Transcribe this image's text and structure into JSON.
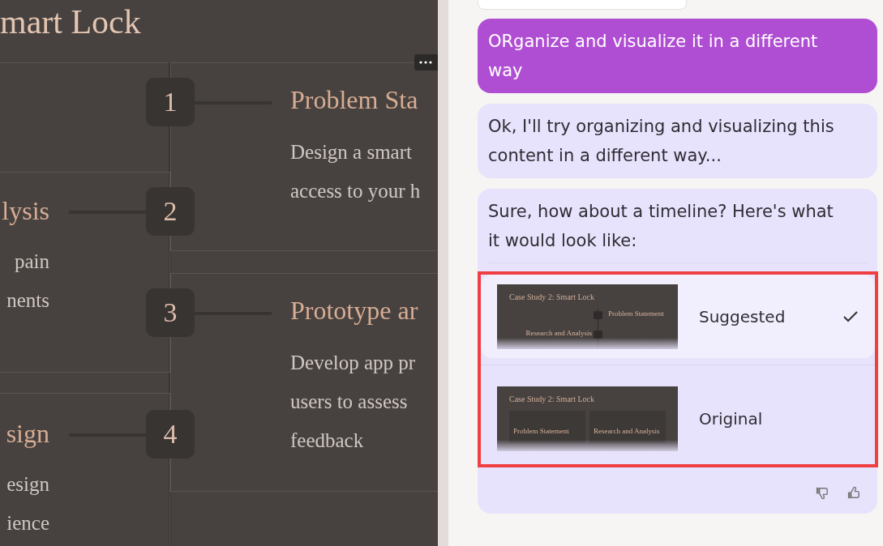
{
  "slide": {
    "title": "mart Lock",
    "timeline": [
      {
        "number": "1",
        "kind": "right",
        "title": "Problem Sta",
        "lines": [
          "Design a smart",
          "access to your h"
        ]
      },
      {
        "number": "2",
        "kind": "left",
        "title": "lysis",
        "lines": [
          "pain",
          "nents"
        ]
      },
      {
        "number": "3",
        "kind": "right",
        "title": "Prototype ar",
        "lines": [
          "Develop app pr",
          "users to assess",
          "feedback"
        ]
      },
      {
        "number": "4",
        "kind": "left",
        "title": "sign",
        "lines": [
          "esign",
          "ience"
        ]
      }
    ]
  },
  "chat": {
    "messages": [
      {
        "kind": "user",
        "text": "ORganize and visualize it in a different way"
      },
      {
        "kind": "assistant",
        "text": "Ok, I'll try organizing and visualizing this content in a different way..."
      },
      {
        "kind": "assistant",
        "text": "Sure, how about a timeline? Here's what it would look like:",
        "options": [
          {
            "label": "Suggested",
            "selected": true,
            "kind": "timeline",
            "thumb_title": "Case Study 2: Smart Lock",
            "thumb_headings": [
              "Problem Statement",
              "Research and Analysis"
            ]
          },
          {
            "label": "Original",
            "selected": false,
            "kind": "grid",
            "thumb_title": "Case Study 2: Smart Lock",
            "thumb_headings": [
              "Problem Statement",
              "Research and Analysis"
            ]
          }
        ]
      }
    ]
  }
}
